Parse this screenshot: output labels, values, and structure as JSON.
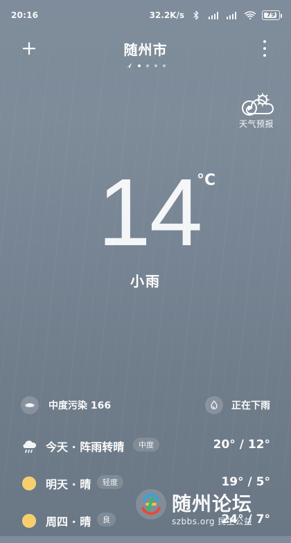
{
  "status_bar": {
    "time": "20:16",
    "network_speed": "32.2K/s",
    "battery_level": "79",
    "icons": [
      "bluetooth-icon",
      "signal-icon",
      "signal-icon",
      "wifi-icon",
      "battery-icon"
    ]
  },
  "header": {
    "city": "随州市",
    "add_icon": "plus-icon",
    "more_icon": "more-vertical-icon",
    "pages_count": 5,
    "active_page_index": 1
  },
  "forecast_shortcut": {
    "label": "天气预报",
    "icon": "cloud-sun-play-icon"
  },
  "current": {
    "temperature": "14",
    "unit": "°C",
    "condition": "小雨"
  },
  "air_quality": {
    "text": "中度污染 166",
    "icon": "mask-icon"
  },
  "precip_status": {
    "text": "正在下雨",
    "icon": "raindrop-icon"
  },
  "daily": [
    {
      "day": "今天 · 阵雨转晴",
      "badge": "中度",
      "temp": "20° / 12°",
      "icon": "cloud-rain-icon",
      "badge_color": "#d9dfe6"
    },
    {
      "day": "明天 · 晴",
      "badge": "轻度",
      "temp": "19° / 5°",
      "icon": "sun-icon",
      "badge_color": "#d9dfe6"
    },
    {
      "day": "周四 · 晴",
      "badge": "良",
      "temp": "24° / 7°",
      "icon": "sun-icon",
      "badge_color": "#d9dfe6"
    }
  ],
  "watermark": {
    "title": "随州论坛",
    "subtitle": "szbbs.org 民生公益"
  },
  "colors": {
    "sun": "#f6cf6b"
  }
}
